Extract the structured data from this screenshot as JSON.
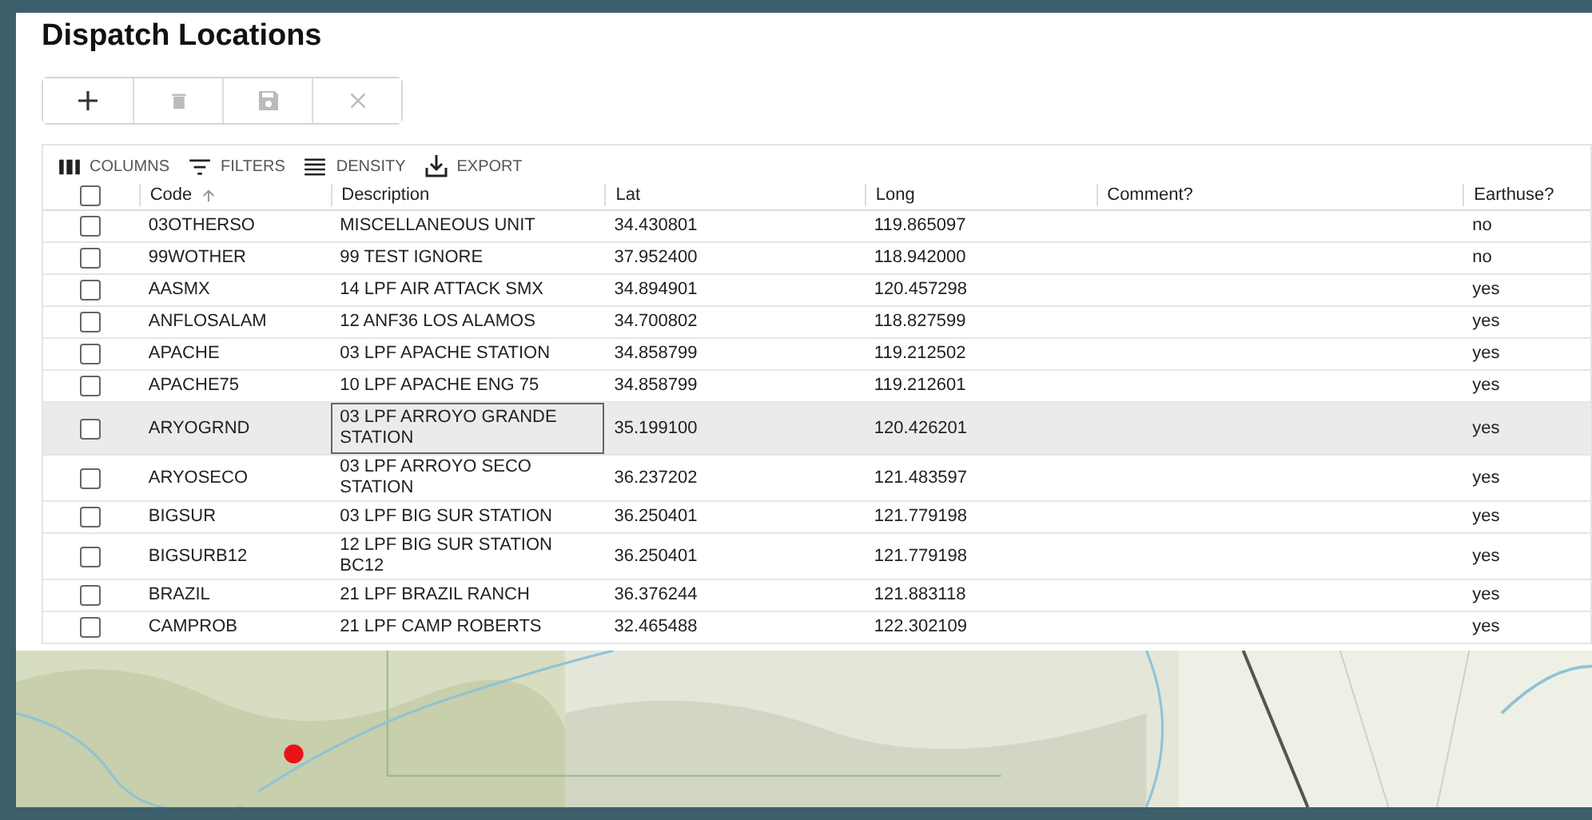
{
  "title": "Dispatch Locations",
  "actions": [
    {
      "kind": "add",
      "disabled": false
    },
    {
      "kind": "delete",
      "disabled": true
    },
    {
      "kind": "save",
      "disabled": true
    },
    {
      "kind": "cancel",
      "disabled": true
    }
  ],
  "grid_toolbar": [
    {
      "kind": "columns",
      "label": "COLUMNS"
    },
    {
      "kind": "filters",
      "label": "FILTERS"
    },
    {
      "kind": "density",
      "label": "DENSITY"
    },
    {
      "kind": "export",
      "label": "EXPORT"
    }
  ],
  "table": {
    "all_checked": false,
    "columns": [
      {
        "label": "Code",
        "sorted_ascending": true
      },
      {
        "label": "Description",
        "sorted_ascending": false
      },
      {
        "label": "Lat",
        "sorted_ascending": false
      },
      {
        "label": "Long",
        "sorted_ascending": false
      },
      {
        "label": "Comment?",
        "sorted_ascending": false
      },
      {
        "label": "Earthuse?",
        "sorted_ascending": false
      }
    ],
    "rows": [
      {
        "checked": false,
        "hovered": false,
        "focused": false,
        "cells": [
          "03OTHERSO",
          "MISCELLANEOUS UNIT",
          "34.430801",
          "119.865097",
          "",
          "no"
        ]
      },
      {
        "checked": false,
        "hovered": false,
        "focused": false,
        "cells": [
          "99WOTHER",
          "99 TEST IGNORE",
          "37.952400",
          "118.942000",
          "",
          "no"
        ]
      },
      {
        "checked": false,
        "hovered": false,
        "focused": false,
        "cells": [
          "AASMX",
          "14 LPF AIR ATTACK SMX",
          "34.894901",
          "120.457298",
          "",
          "yes"
        ]
      },
      {
        "checked": false,
        "hovered": false,
        "focused": false,
        "cells": [
          "ANFLOSALAM",
          "12 ANF36 LOS ALAMOS",
          "34.700802",
          "118.827599",
          "",
          "yes"
        ]
      },
      {
        "checked": false,
        "hovered": false,
        "focused": false,
        "cells": [
          "APACHE",
          "03 LPF APACHE STATION",
          "34.858799",
          "119.212502",
          "",
          "yes"
        ]
      },
      {
        "checked": false,
        "hovered": false,
        "focused": false,
        "cells": [
          "APACHE75",
          "10 LPF APACHE ENG 75",
          "34.858799",
          "119.212601",
          "",
          "yes"
        ]
      },
      {
        "checked": false,
        "hovered": true,
        "focused": true,
        "cells": [
          "ARYOGRND",
          "03 LPF ARROYO GRANDE STATION",
          "35.199100",
          "120.426201",
          "",
          "yes"
        ]
      },
      {
        "checked": false,
        "hovered": false,
        "focused": false,
        "cells": [
          "ARYOSECO",
          "03 LPF ARROYO SECO STATION",
          "36.237202",
          "121.483597",
          "",
          "yes"
        ]
      },
      {
        "checked": false,
        "hovered": false,
        "focused": false,
        "cells": [
          "BIGSUR",
          "03 LPF BIG SUR STATION",
          "36.250401",
          "121.779198",
          "",
          "yes"
        ]
      },
      {
        "checked": false,
        "hovered": false,
        "focused": false,
        "cells": [
          "BIGSURB12",
          "12 LPF BIG SUR STATION BC12",
          "36.250401",
          "121.779198",
          "",
          "yes"
        ]
      },
      {
        "checked": false,
        "hovered": false,
        "focused": false,
        "cells": [
          "BRAZIL",
          "21 LPF BRAZIL RANCH",
          "36.376244",
          "121.883118",
          "",
          "yes"
        ]
      },
      {
        "checked": false,
        "hovered": false,
        "focused": false,
        "cells": [
          "CAMPROB",
          "21 LPF CAMP ROBERTS",
          "32.465488",
          "122.302109",
          "",
          "yes"
        ]
      }
    ]
  }
}
